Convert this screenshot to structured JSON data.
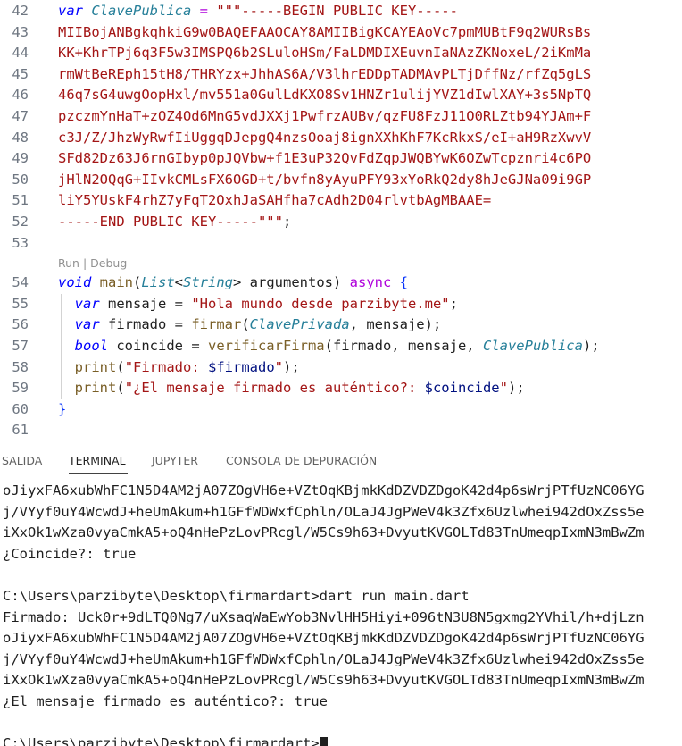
{
  "editor": {
    "lines": [
      {
        "n": "42",
        "tokens": [
          {
            "t": "var",
            "c": "kw"
          },
          {
            "t": " ",
            "c": "punc"
          },
          {
            "t": "ClavePublica",
            "c": "cls"
          },
          {
            "t": " = ",
            "c": "kw2"
          },
          {
            "t": "\"\"\"-----BEGIN PUBLIC KEY-----",
            "c": "str"
          }
        ]
      },
      {
        "n": "43",
        "tokens": [
          {
            "t": "MIIBojANBgkqhkiG9w0BAQEFAAOCAY8AMIIBigKCAYEAoVc7pmMUBtF9q2WURsBs",
            "c": "str"
          }
        ]
      },
      {
        "n": "44",
        "tokens": [
          {
            "t": "KK+KhrTPj6q3F5w3IMSPQ6b2SLuloHSm/FaLDMDIXEuvnIaNAzZKNoxeL/2iKmMa",
            "c": "str"
          }
        ]
      },
      {
        "n": "45",
        "tokens": [
          {
            "t": "rmWtBeREph15tH8/THRYzx+JhhAS6A/V3lhrEDDpTADMAvPLTjDffNz/rfZq5gLS",
            "c": "str"
          }
        ]
      },
      {
        "n": "46",
        "tokens": [
          {
            "t": "46q7sG4uwgOopHxl/mv551a0GulLdKXO8Sv1HNZr1ulijYVZ1dIwlXAY+3s5NpTQ",
            "c": "str"
          }
        ]
      },
      {
        "n": "47",
        "tokens": [
          {
            "t": "pzczmYnHaT+zOZ4Od6MnG5vdJXXj1PwfrzAUBv/qzFU8FzJ11O0RLZtb94YJAm+F",
            "c": "str"
          }
        ]
      },
      {
        "n": "48",
        "tokens": [
          {
            "t": "c3J/Z/JhzWyRwfIiUggqDJepgQ4nzsOoaj8ignXXhKhF7KcRkxS/eI+aH9RzXwvV",
            "c": "str"
          }
        ]
      },
      {
        "n": "49",
        "tokens": [
          {
            "t": "SFd82Dz63J6rnGIbyp0pJQVbw+f1E3uP32QvFdZqpJWQBYwK6OZwTcpznri4c6PO",
            "c": "str"
          }
        ]
      },
      {
        "n": "50",
        "tokens": [
          {
            "t": "jHlN2OQqG+IIvkCMLsFX6OGD+t/bvfn8yAyuPFY93xYoRkQ2dy8hJeGJNa09i9GP",
            "c": "str"
          }
        ]
      },
      {
        "n": "51",
        "tokens": [
          {
            "t": "liY5YUskF4rhZ7yFqT2OxhJaSAHfha7cAdh2D04rlvtbAgMBAAE=",
            "c": "str"
          }
        ]
      },
      {
        "n": "52",
        "tokens": [
          {
            "t": "-----END PUBLIC KEY-----\"\"\"",
            "c": "str"
          },
          {
            "t": ";",
            "c": "punc"
          }
        ]
      },
      {
        "n": "53",
        "tokens": []
      },
      {
        "n": "54",
        "tokens": [
          {
            "t": "void",
            "c": "kw"
          },
          {
            "t": " ",
            "c": "punc"
          },
          {
            "t": "main",
            "c": "fn"
          },
          {
            "t": "(",
            "c": "punc"
          },
          {
            "t": "List",
            "c": "cls"
          },
          {
            "t": "<",
            "c": "punc"
          },
          {
            "t": "String",
            "c": "cls"
          },
          {
            "t": "> argumentos) ",
            "c": "punc"
          },
          {
            "t": "async",
            "c": "kw2"
          },
          {
            "t": " ",
            "c": "punc"
          },
          {
            "t": "{",
            "c": "brace"
          }
        ]
      },
      {
        "n": "55",
        "tokens": [
          {
            "t": "  ",
            "c": "punc"
          },
          {
            "t": "var",
            "c": "kw"
          },
          {
            "t": " mensaje = ",
            "c": "ident"
          },
          {
            "t": "\"Hola mundo desde parzibyte.me\"",
            "c": "str"
          },
          {
            "t": ";",
            "c": "punc"
          }
        ]
      },
      {
        "n": "56",
        "tokens": [
          {
            "t": "  ",
            "c": "punc"
          },
          {
            "t": "var",
            "c": "kw"
          },
          {
            "t": " firmado = ",
            "c": "ident"
          },
          {
            "t": "firmar",
            "c": "fn"
          },
          {
            "t": "(",
            "c": "punc"
          },
          {
            "t": "ClavePrivada",
            "c": "cls"
          },
          {
            "t": ", mensaje);",
            "c": "punc"
          }
        ]
      },
      {
        "n": "57",
        "tokens": [
          {
            "t": "  ",
            "c": "punc"
          },
          {
            "t": "bool",
            "c": "kw"
          },
          {
            "t": " coincide = ",
            "c": "ident"
          },
          {
            "t": "verificarFirma",
            "c": "fn"
          },
          {
            "t": "(firmado, mensaje, ",
            "c": "punc"
          },
          {
            "t": "ClavePublica",
            "c": "cls"
          },
          {
            "t": ");",
            "c": "punc"
          }
        ]
      },
      {
        "n": "58",
        "tokens": [
          {
            "t": "  ",
            "c": "punc"
          },
          {
            "t": "print",
            "c": "fn"
          },
          {
            "t": "(",
            "c": "punc"
          },
          {
            "t": "\"Firmado: ",
            "c": "str"
          },
          {
            "t": "$firmado",
            "c": "interp"
          },
          {
            "t": "\"",
            "c": "str"
          },
          {
            "t": ");",
            "c": "punc"
          }
        ]
      },
      {
        "n": "59",
        "tokens": [
          {
            "t": "  ",
            "c": "punc"
          },
          {
            "t": "print",
            "c": "fn"
          },
          {
            "t": "(",
            "c": "punc"
          },
          {
            "t": "\"¿El mensaje firmado es auténtico?: ",
            "c": "str"
          },
          {
            "t": "$coincide",
            "c": "interp"
          },
          {
            "t": "\"",
            "c": "str"
          },
          {
            "t": ");",
            "c": "punc"
          }
        ]
      },
      {
        "n": "60",
        "tokens": [
          {
            "t": "}",
            "c": "brace"
          }
        ]
      },
      {
        "n": "61",
        "tokens": []
      }
    ],
    "codelens": {
      "run": "Run",
      "sep": " | ",
      "debug": "Debug"
    }
  },
  "panel": {
    "tabs": [
      {
        "label": "SALIDA",
        "active": false
      },
      {
        "label": "TERMINAL",
        "active": true
      },
      {
        "label": "JUPYTER",
        "active": false
      },
      {
        "label": "CONSOLA DE DEPURACIÓN",
        "active": false
      }
    ],
    "terminal_lines": [
      "oJiyxFA6xubWhFC1N5D4AM2jA07ZOgVH6e+VZtOqKBjmkKdDZVDZDgoK42d4p6sWrjPTfUzNC06YG",
      "j/VYyf0uY4WcwdJ+heUmAkum+h1GFfWDWxfCphln/OLaJ4JgPWeV4k3Zfx6Uzlwhei942dOxZss5e",
      "iXxOk1wXza0vyaCmkA5+oQ4nHePzLovPRcgl/W5Cs9h63+DvyutKVGOLTd83TnUmeqpIxmN3mBwZm",
      "¿Coincide?: true",
      "",
      "C:\\Users\\parzibyte\\Desktop\\firmardart>dart run main.dart",
      "Firmado: Uck0r+9dLTQ0Ng7/uXsaqWaEwYob3NvlHH5Hiyi+096tN3U8N5gxmg2YVhil/h+djLzn",
      "oJiyxFA6xubWhFC1N5D4AM2jA07ZOgVH6e+VZtOqKBjmkKdDZVDZDgoK42d4p6sWrjPTfUzNC06YG",
      "j/VYyf0uY4WcwdJ+heUmAkum+h1GFfWDWxfCphln/OLaJ4JgPWeV4k3Zfx6Uzlwhei942dOxZss5e",
      "iXxOk1wXza0vyaCmkA5+oQ4nHePzLovPRcgl/W5Cs9h63+DvyutKVGOLTd83TnUmeqpIxmN3mBwZm",
      "¿El mensaje firmado es auténtico?: true",
      "",
      "C:\\Users\\parzibyte\\Desktop\\firmardart>"
    ]
  }
}
